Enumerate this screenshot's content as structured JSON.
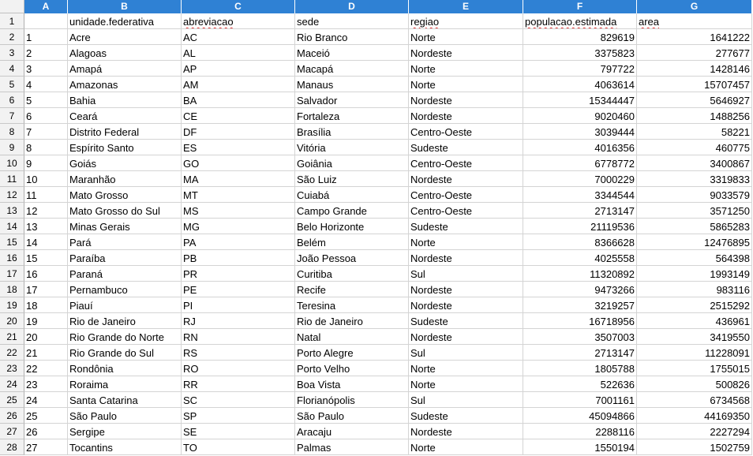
{
  "columns": [
    "A",
    "B",
    "C",
    "D",
    "E",
    "F",
    "G"
  ],
  "header_row": {
    "row_number": "1",
    "cells": [
      "",
      "unidade.federativa",
      "abreviacao",
      "sede",
      "regiao",
      "populacao.estimada",
      "area"
    ]
  },
  "rows": [
    {
      "n": "2",
      "cells": [
        "1",
        "Acre",
        "AC",
        "Rio Branco",
        "Norte",
        "829619",
        "1641222"
      ]
    },
    {
      "n": "3",
      "cells": [
        "2",
        "Alagoas",
        "AL",
        "Maceió",
        "Nordeste",
        "3375823",
        "277677"
      ]
    },
    {
      "n": "4",
      "cells": [
        "3",
        "Amapá",
        "AP",
        "Macapá",
        "Norte",
        "797722",
        "1428146"
      ]
    },
    {
      "n": "5",
      "cells": [
        "4",
        "Amazonas",
        "AM",
        "Manaus",
        "Norte",
        "4063614",
        "15707457"
      ]
    },
    {
      "n": "6",
      "cells": [
        "5",
        "Bahia",
        "BA",
        "Salvador",
        "Nordeste",
        "15344447",
        "5646927"
      ]
    },
    {
      "n": "7",
      "cells": [
        "6",
        "Ceará",
        "CE",
        "Fortaleza",
        "Nordeste",
        "9020460",
        "1488256"
      ]
    },
    {
      "n": "8",
      "cells": [
        "7",
        "Distrito Federal",
        "DF",
        "Brasília",
        "Centro-Oeste",
        "3039444",
        "58221"
      ]
    },
    {
      "n": "9",
      "cells": [
        "8",
        "Espírito Santo",
        "ES",
        "Vitória",
        "Sudeste",
        "4016356",
        "460775"
      ]
    },
    {
      "n": "10",
      "cells": [
        "9",
        "Goiás",
        "GO",
        "Goiânia",
        "Centro-Oeste",
        "6778772",
        "3400867"
      ]
    },
    {
      "n": "11",
      "cells": [
        "10",
        "Maranhão",
        "MA",
        "São Luiz",
        "Nordeste",
        "7000229",
        "3319833"
      ]
    },
    {
      "n": "12",
      "cells": [
        "11",
        "Mato Grosso",
        "MT",
        "Cuiabá",
        "Centro-Oeste",
        "3344544",
        "9033579"
      ]
    },
    {
      "n": "13",
      "cells": [
        "12",
        "Mato Grosso do Sul",
        "MS",
        "Campo Grande",
        "Centro-Oeste",
        "2713147",
        "3571250"
      ]
    },
    {
      "n": "14",
      "cells": [
        "13",
        "Minas Gerais",
        "MG",
        "Belo Horizonte",
        "Sudeste",
        "21119536",
        "5865283"
      ]
    },
    {
      "n": "15",
      "cells": [
        "14",
        "Pará",
        "PA",
        "Belém",
        "Norte",
        "8366628",
        "12476895"
      ]
    },
    {
      "n": "16",
      "cells": [
        "15",
        "Paraíba",
        "PB",
        "João Pessoa",
        "Nordeste",
        "4025558",
        "564398"
      ]
    },
    {
      "n": "17",
      "cells": [
        "16",
        "Paraná",
        "PR",
        "Curitiba",
        "Sul",
        "11320892",
        "1993149"
      ]
    },
    {
      "n": "18",
      "cells": [
        "17",
        "Pernambuco",
        "PE",
        "Recife",
        "Nordeste",
        "9473266",
        "983116"
      ]
    },
    {
      "n": "19",
      "cells": [
        "18",
        "Piauí",
        "PI",
        "Teresina",
        "Nordeste",
        "3219257",
        "2515292"
      ]
    },
    {
      "n": "20",
      "cells": [
        "19",
        "Rio de Janeiro",
        "RJ",
        "Rio de Janeiro",
        "Sudeste",
        "16718956",
        "436961"
      ]
    },
    {
      "n": "21",
      "cells": [
        "20",
        "Rio Grande do Norte",
        "RN",
        "Natal",
        "Nordeste",
        "3507003",
        "3419550"
      ]
    },
    {
      "n": "22",
      "cells": [
        "21",
        "Rio Grande do Sul",
        "RS",
        "Porto Alegre",
        "Sul",
        "2713147",
        "11228091"
      ]
    },
    {
      "n": "23",
      "cells": [
        "22",
        "Rondônia",
        "RO",
        "Porto Velho",
        "Norte",
        "1805788",
        "1755015"
      ]
    },
    {
      "n": "24",
      "cells": [
        "23",
        "Roraima",
        "RR",
        "Boa Vista",
        "Norte",
        "522636",
        "500826"
      ]
    },
    {
      "n": "25",
      "cells": [
        "24",
        "Santa Catarina",
        "SC",
        "Florianópolis",
        "Sul",
        "7001161",
        "6734568"
      ]
    },
    {
      "n": "26",
      "cells": [
        "25",
        "São Paulo",
        "SP",
        "São Paulo",
        "Sudeste",
        "45094866",
        "44169350"
      ]
    },
    {
      "n": "27",
      "cells": [
        "26",
        "Sergipe",
        "SE",
        "Aracaju",
        "Nordeste",
        "2288116",
        "2227294"
      ]
    },
    {
      "n": "28",
      "cells": [
        "27",
        "Tocantins",
        "TO",
        "Palmas",
        "Norte",
        "1550194",
        "1502759"
      ]
    }
  ],
  "colors": {
    "column_header_bg": "#2f81d4",
    "row_header_bg": "#f2f2f2",
    "gridline": "#d4d4d4",
    "spellcheck": "#e03030"
  }
}
